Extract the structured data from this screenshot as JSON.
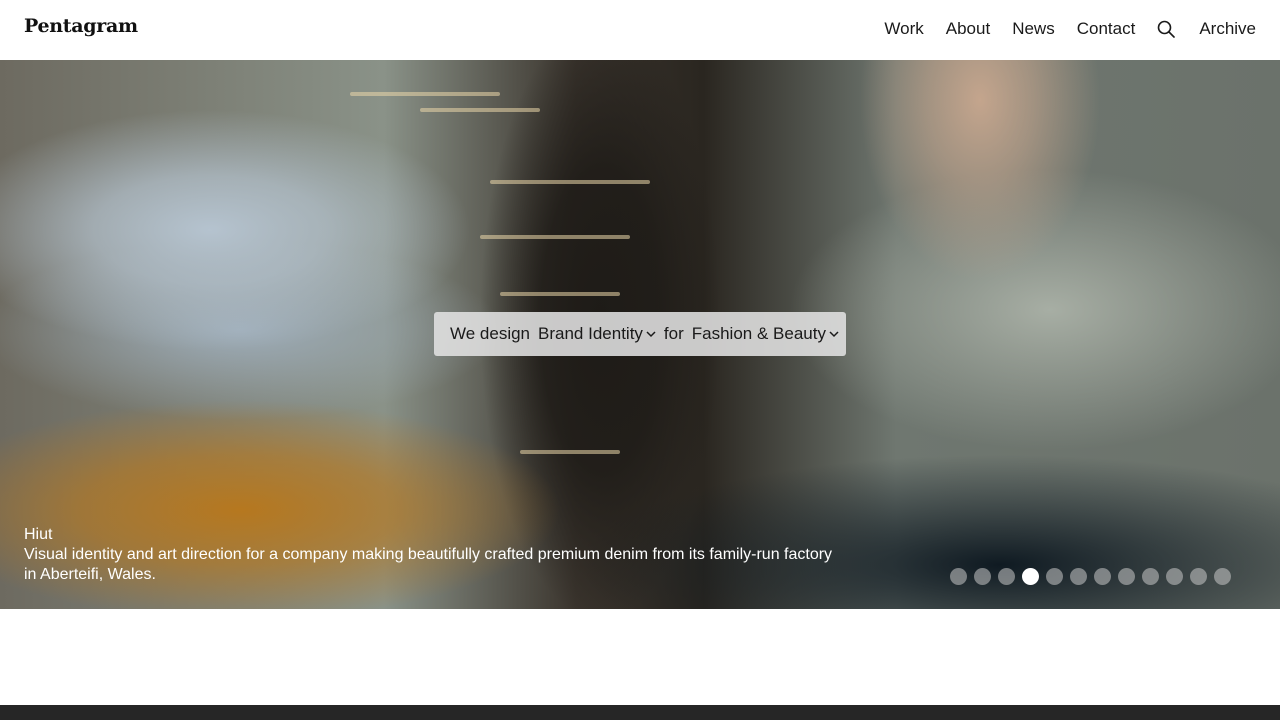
{
  "header": {
    "logo": "Pentagram",
    "nav": [
      "Work",
      "About",
      "News",
      "Contact"
    ],
    "search_icon": "search-icon",
    "archive": "Archive"
  },
  "hero": {
    "selector": {
      "prefix": "We design",
      "discipline": "Brand Identity",
      "connector": "for",
      "sector": "Fashion & Beauty",
      "dropdown_icon": "chevron-down-icon"
    },
    "caption": {
      "title": "Hiut",
      "description": "Visual identity and art direction for a company making beautifully crafted premium denim from its family-run factory in Aberteifi, Wales."
    },
    "pagination": {
      "total": 12,
      "active_index": 3
    }
  },
  "colors": {
    "header_bg": "#ffffff",
    "footer_bar": "#262626",
    "dot_active": "#ffffff",
    "dot_inactive": "#c8c8c8"
  }
}
